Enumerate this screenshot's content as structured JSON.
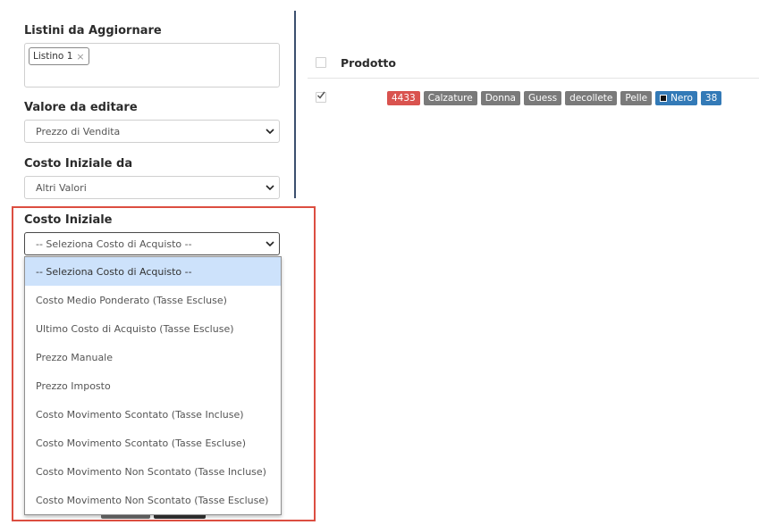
{
  "left_form": {
    "listini_label": "Listini da Aggiornare",
    "listini_tag": "Listino 1",
    "listini_tag_remove": "×",
    "valore_label": "Valore da editare",
    "valore_value": "Prezzo di Vendita",
    "costo_da_label": "Costo Iniziale da",
    "costo_da_value": "Altri Valori",
    "costo_iniziale_label": "Costo Iniziale",
    "costo_iniziale_value": "-- Seleziona Costo di Acquisto --",
    "options": [
      "-- Seleziona Costo di Acquisto --",
      "Costo Medio Ponderato (Tasse Escluse)",
      "Ultimo Costo di Acquisto (Tasse Escluse)",
      "Prezzo Manuale",
      "Prezzo Imposto",
      "Costo Movimento Scontato (Tasse Incluse)",
      "Costo Movimento Scontato (Tasse Escluse)",
      "Costo Movimento Non Scontato (Tasse Incluse)",
      "Costo Movimento Non Scontato (Tasse Escluse)"
    ],
    "selected_option_index": 0
  },
  "product_table": {
    "header": "Prodotto",
    "row_checked": true,
    "badges": [
      {
        "text": "4433",
        "color": "#d9534f"
      },
      {
        "text": "Calzature",
        "color": "#7a7a7a"
      },
      {
        "text": "Donna",
        "color": "#7a7a7a"
      },
      {
        "text": "Guess",
        "color": "#7a7a7a"
      },
      {
        "text": "decollete",
        "color": "#7a7a7a"
      },
      {
        "text": "Pelle",
        "color": "#7a7a7a"
      },
      {
        "text": "Nero",
        "color": "#337ab7"
      },
      {
        "text": "38",
        "color": "#337ab7"
      }
    ]
  },
  "colors": {
    "highlight": "#dc4e41",
    "divider": "#3b4f6e",
    "selected_option_bg": "#cde2fb"
  }
}
